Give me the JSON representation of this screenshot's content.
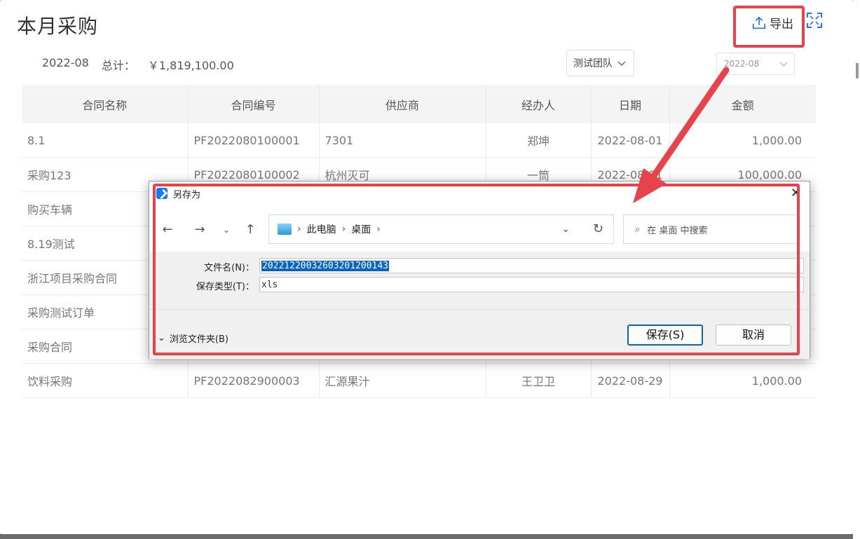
{
  "page": {
    "title": "本月采购",
    "export_label": "导出",
    "month": "2022-08",
    "total_label": "总计：",
    "total_value": "￥1,819,100.00",
    "team_select": "测试团队",
    "month_picker": "2022-08"
  },
  "table": {
    "headers": [
      "合同名称",
      "合同编号",
      "供应商",
      "经办人",
      "日期",
      "金额"
    ],
    "rows": [
      [
        "8.1",
        "PF2022080100001",
        "7301",
        "郑坤",
        "2022-08-01",
        "1,000.00"
      ],
      [
        "采购123",
        "PF2022080100002",
        "杭州灭可",
        "一筒",
        "2022-08-01",
        "100,000.00"
      ],
      [
        "购买车辆",
        "",
        "",
        "",
        "",
        ""
      ],
      [
        "8.19测试",
        "",
        "",
        "",
        "",
        ""
      ],
      [
        "浙江项目采购合同",
        "",
        "",
        "",
        "",
        ""
      ],
      [
        "采购测试订单",
        "",
        "",
        "",
        "",
        ""
      ],
      [
        "采购合同",
        "",
        "",
        "",
        "",
        ""
      ],
      [
        "饮料采购",
        "PF2022082900003",
        "汇源果汁",
        "王卫卫",
        "2022-08-29",
        "1,000.00"
      ]
    ]
  },
  "dialog": {
    "title": "另存为",
    "path": [
      "此电脑",
      "桌面"
    ],
    "search_placeholder": "在 桌面 中搜索",
    "filename_label": "文件名(N)：",
    "filename_value": "20221220032603201200143",
    "filetype_label": "保存类型(T)：",
    "filetype_value": "xls",
    "browse_label": "浏览文件夹(B)",
    "save_label": "保存(S)",
    "cancel_label": "取消"
  },
  "colors": {
    "highlight": "#e8434a",
    "selection": "#0a64c8",
    "accent": "#1677ff"
  }
}
